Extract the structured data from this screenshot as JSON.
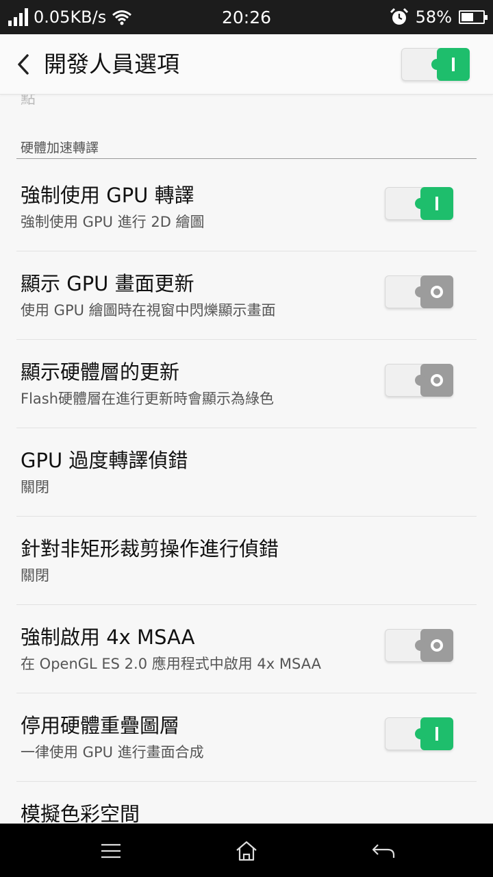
{
  "status_bar": {
    "speed": "0.05KB/s",
    "time": "20:26",
    "battery_percent": "58%",
    "battery_level": 0.58,
    "icons": [
      "signal-icon",
      "wifi-icon",
      "alarm-icon",
      "battery-icon"
    ]
  },
  "header": {
    "title": "開發人員選項",
    "master_toggle_on": true,
    "back_icon": "chevron-left-icon"
  },
  "cut_text": "點",
  "section": {
    "title": "硬體加速轉譯"
  },
  "rows": [
    {
      "title": "強制使用 GPU 轉譯",
      "subtitle": "強制使用 GPU 進行 2D 繪圖",
      "has_toggle": true,
      "toggle_on": true
    },
    {
      "title": "顯示 GPU 畫面更新",
      "subtitle": "使用 GPU 繪圖時在視窗中閃爍顯示畫面",
      "has_toggle": true,
      "toggle_on": false
    },
    {
      "title": "顯示硬體層的更新",
      "subtitle": "Flash硬體層在進行更新時會顯示為綠色",
      "has_toggle": true,
      "toggle_on": false
    },
    {
      "title": "GPU 過度轉譯偵錯",
      "subtitle": "關閉",
      "has_toggle": false
    },
    {
      "title": "針對非矩形裁剪操作進行偵錯",
      "subtitle": "關閉",
      "has_toggle": false
    },
    {
      "title": "強制啟用 4x MSAA",
      "subtitle": "在 OpenGL ES 2.0 應用程式中啟用 4x MSAA",
      "has_toggle": true,
      "toggle_on": false
    },
    {
      "title": "停用硬體重疊圖層",
      "subtitle": "一律使用 GPU 進行畫面合成",
      "has_toggle": true,
      "toggle_on": true
    },
    {
      "title": "模擬色彩空間",
      "subtitle": "",
      "has_toggle": false
    }
  ],
  "colors": {
    "toggle_on": "#1ebe6c",
    "toggle_off": "#9c9c9c",
    "background": "#f7f7f7",
    "status_bar": "#1c1c1c",
    "nav_bar": "#000000"
  },
  "nav": {
    "menu_icon": "menu-icon",
    "home_icon": "home-icon",
    "back_icon": "back-arrow-icon"
  }
}
